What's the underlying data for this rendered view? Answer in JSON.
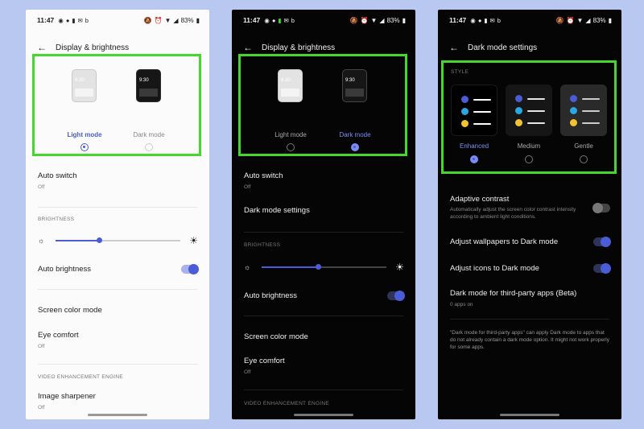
{
  "colors": {
    "accent": "#4a5cd6",
    "highlight": "#47d62f",
    "background": "#b9c8f1"
  },
  "status_bar": {
    "time": "11:47",
    "battery": "83%"
  },
  "panel1": {
    "title": "Display & brightness",
    "mode_light_mock_time": "9:30",
    "mode_dark_mock_time": "9:30",
    "light_mode_label": "Light mode",
    "dark_mode_label": "Dark mode",
    "selected_mode": "Light mode",
    "auto_switch": {
      "title": "Auto switch",
      "sub": "Off"
    },
    "brightness_header": "BRIGHTNESS",
    "brightness_level": 0.35,
    "auto_brightness": {
      "title": "Auto brightness",
      "on": true
    },
    "screen_color_mode": "Screen color mode",
    "eye_comfort": {
      "title": "Eye comfort",
      "sub": "Off"
    },
    "video_header": "VIDEO ENHANCEMENT ENGINE",
    "image_sharpener": {
      "title": "Image sharpener",
      "sub": "Off"
    }
  },
  "panel2": {
    "title": "Display & brightness",
    "mode_light_mock_time": "9:30",
    "mode_dark_mock_time": "9:30",
    "light_mode_label": "Light mode",
    "dark_mode_label": "Dark mode",
    "selected_mode": "Dark mode",
    "auto_switch": {
      "title": "Auto switch",
      "sub": "Off"
    },
    "dark_mode_settings": "Dark mode settings",
    "brightness_header": "BRIGHTNESS",
    "brightness_level": 0.45,
    "auto_brightness": {
      "title": "Auto brightness",
      "on": true
    },
    "screen_color_mode": "Screen color mode",
    "eye_comfort": {
      "title": "Eye comfort",
      "sub": "Off"
    },
    "video_header": "VIDEO ENHANCEMENT ENGINE"
  },
  "panel3": {
    "title": "Dark mode settings",
    "style_header": "STYLE",
    "styles": [
      "Enhanced",
      "Medium",
      "Gentle"
    ],
    "selected_style": "Enhanced",
    "adaptive_contrast": {
      "title": "Adaptive contrast",
      "sub": "Automatically adjust the screen color contrast intensity according to ambient light conditions.",
      "on": false
    },
    "adjust_wallpapers": {
      "title": "Adjust wallpapers to Dark mode",
      "on": true
    },
    "adjust_icons": {
      "title": "Adjust icons to Dark mode",
      "on": true
    },
    "third_party": {
      "title": "Dark mode for third-party apps (Beta)",
      "sub": "0 apps on"
    },
    "note": "\"Dark mode for third-party apps\" can apply Dark mode to apps that do not already contain a dark mode option. It might not work properly for some apps."
  }
}
